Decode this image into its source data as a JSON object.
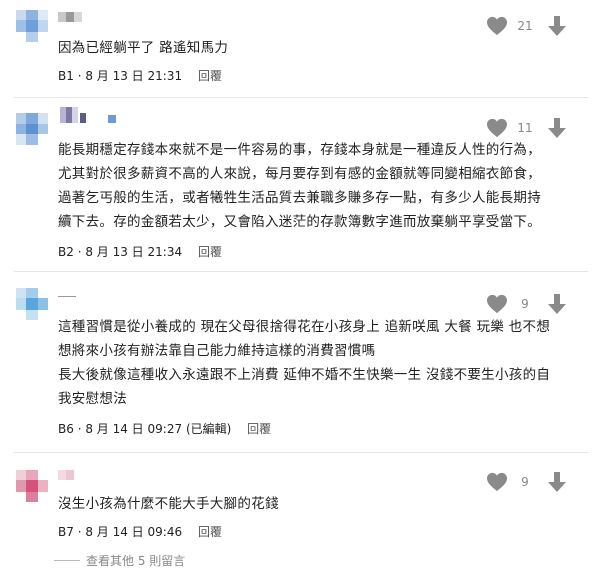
{
  "comments": [
    {
      "floor": "B1",
      "date": "8 月 13 日",
      "time": "21:31",
      "edited": "",
      "likes": "21",
      "lines": [
        "因為已經躺平了 路遙知馬力"
      ],
      "reply_label": "回覆"
    },
    {
      "floor": "B2",
      "date": "8 月 13 日",
      "time": "21:34",
      "edited": "",
      "likes": "11",
      "lines": [
        "能長期穩定存錢本來就不是一件容易的事，存錢本身就是一種違反人性的行為，",
        "尤其對於很多薪資不高的人來說，每月要存到有感的金額就等同變相縮衣節食，",
        "過著乞丐般的生活，或者犧牲生活品質去兼職多賺多存一點，有多少人能長期持",
        "續下去。存的金額若太少，又會陷入迷茫的存款簿數字進而放棄躺平享受當下。"
      ],
      "reply_label": "回覆"
    },
    {
      "floor": "B6",
      "date": "8 月 14 日",
      "time": "09:27",
      "edited": "(已編輯)",
      "likes": "9",
      "lines": [
        "這種習慣是從小養成的 現在父母很捨得花在小孩身上 追新咲風 大餐 玩樂 也不想",
        "想將來小孩有辦法靠自己能力維持這樣的消費習慣嗎",
        "長大後就像這種收入永遠跟不上消費 延伸不婚不生快樂一生 沒錢不要生小孩的自",
        "我安慰想法"
      ],
      "reply_label": "回覆"
    },
    {
      "floor": "B7",
      "date": "8 月 14 日",
      "time": "09:46",
      "edited": "",
      "likes": "9",
      "lines": [
        "沒生小孩為什麼不能大手大腳的花錢"
      ],
      "reply_label": "回覆"
    }
  ],
  "more_replies": "查看其他 5 則留言",
  "icons": {
    "like": "heart-icon",
    "dislike": "arrow-down-icon"
  },
  "colors": {
    "icon": "#8a8a8a",
    "divider": "#e6e6e6"
  }
}
